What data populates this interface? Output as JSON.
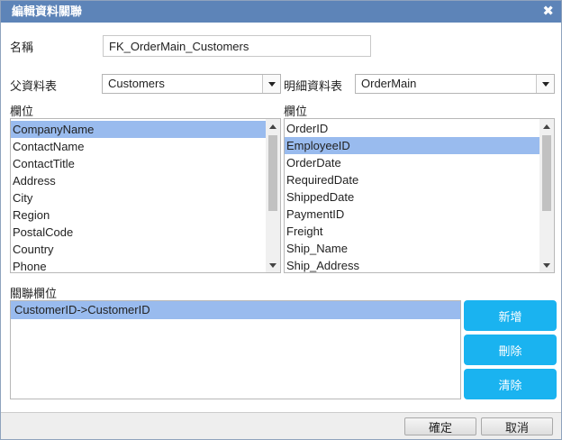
{
  "dialog": {
    "title": "編輯資料關聯",
    "close_glyph": "✖"
  },
  "form": {
    "name_label": "名稱",
    "name_value": "FK_OrderMain_Customers",
    "parent_label": "父資料表",
    "parent_value": "Customers",
    "detail_label": "明細資料表",
    "detail_value": "OrderMain"
  },
  "parent_fields": {
    "label": "欄位",
    "items": [
      "CompanyName",
      "ContactName",
      "ContactTitle",
      "Address",
      "City",
      "Region",
      "PostalCode",
      "Country",
      "Phone"
    ],
    "selected_index": 0
  },
  "detail_fields": {
    "label": "欄位",
    "items": [
      "OrderID",
      "EmployeeID",
      "OrderDate",
      "RequiredDate",
      "ShippedDate",
      "PaymentID",
      "Freight",
      "Ship_Name",
      "Ship_Address"
    ],
    "selected_index": 1
  },
  "relations": {
    "label": "關聯欄位",
    "items": [
      "CustomerID->CustomerID"
    ],
    "selected_index": 0
  },
  "actions": {
    "add_label": "新增",
    "delete_label": "刪除",
    "clear_label": "清除"
  },
  "footer": {
    "ok_label": "確定",
    "cancel_label": "取消"
  },
  "colors": {
    "titlebar": "#5d84b8",
    "selection": "#99bbee",
    "action_button": "#1ab3f0"
  },
  "icons": {
    "close": "close-icon",
    "dropdown": "chevron-down-icon",
    "scroll_up": "scroll-up-icon",
    "scroll_down": "scroll-down-icon"
  }
}
